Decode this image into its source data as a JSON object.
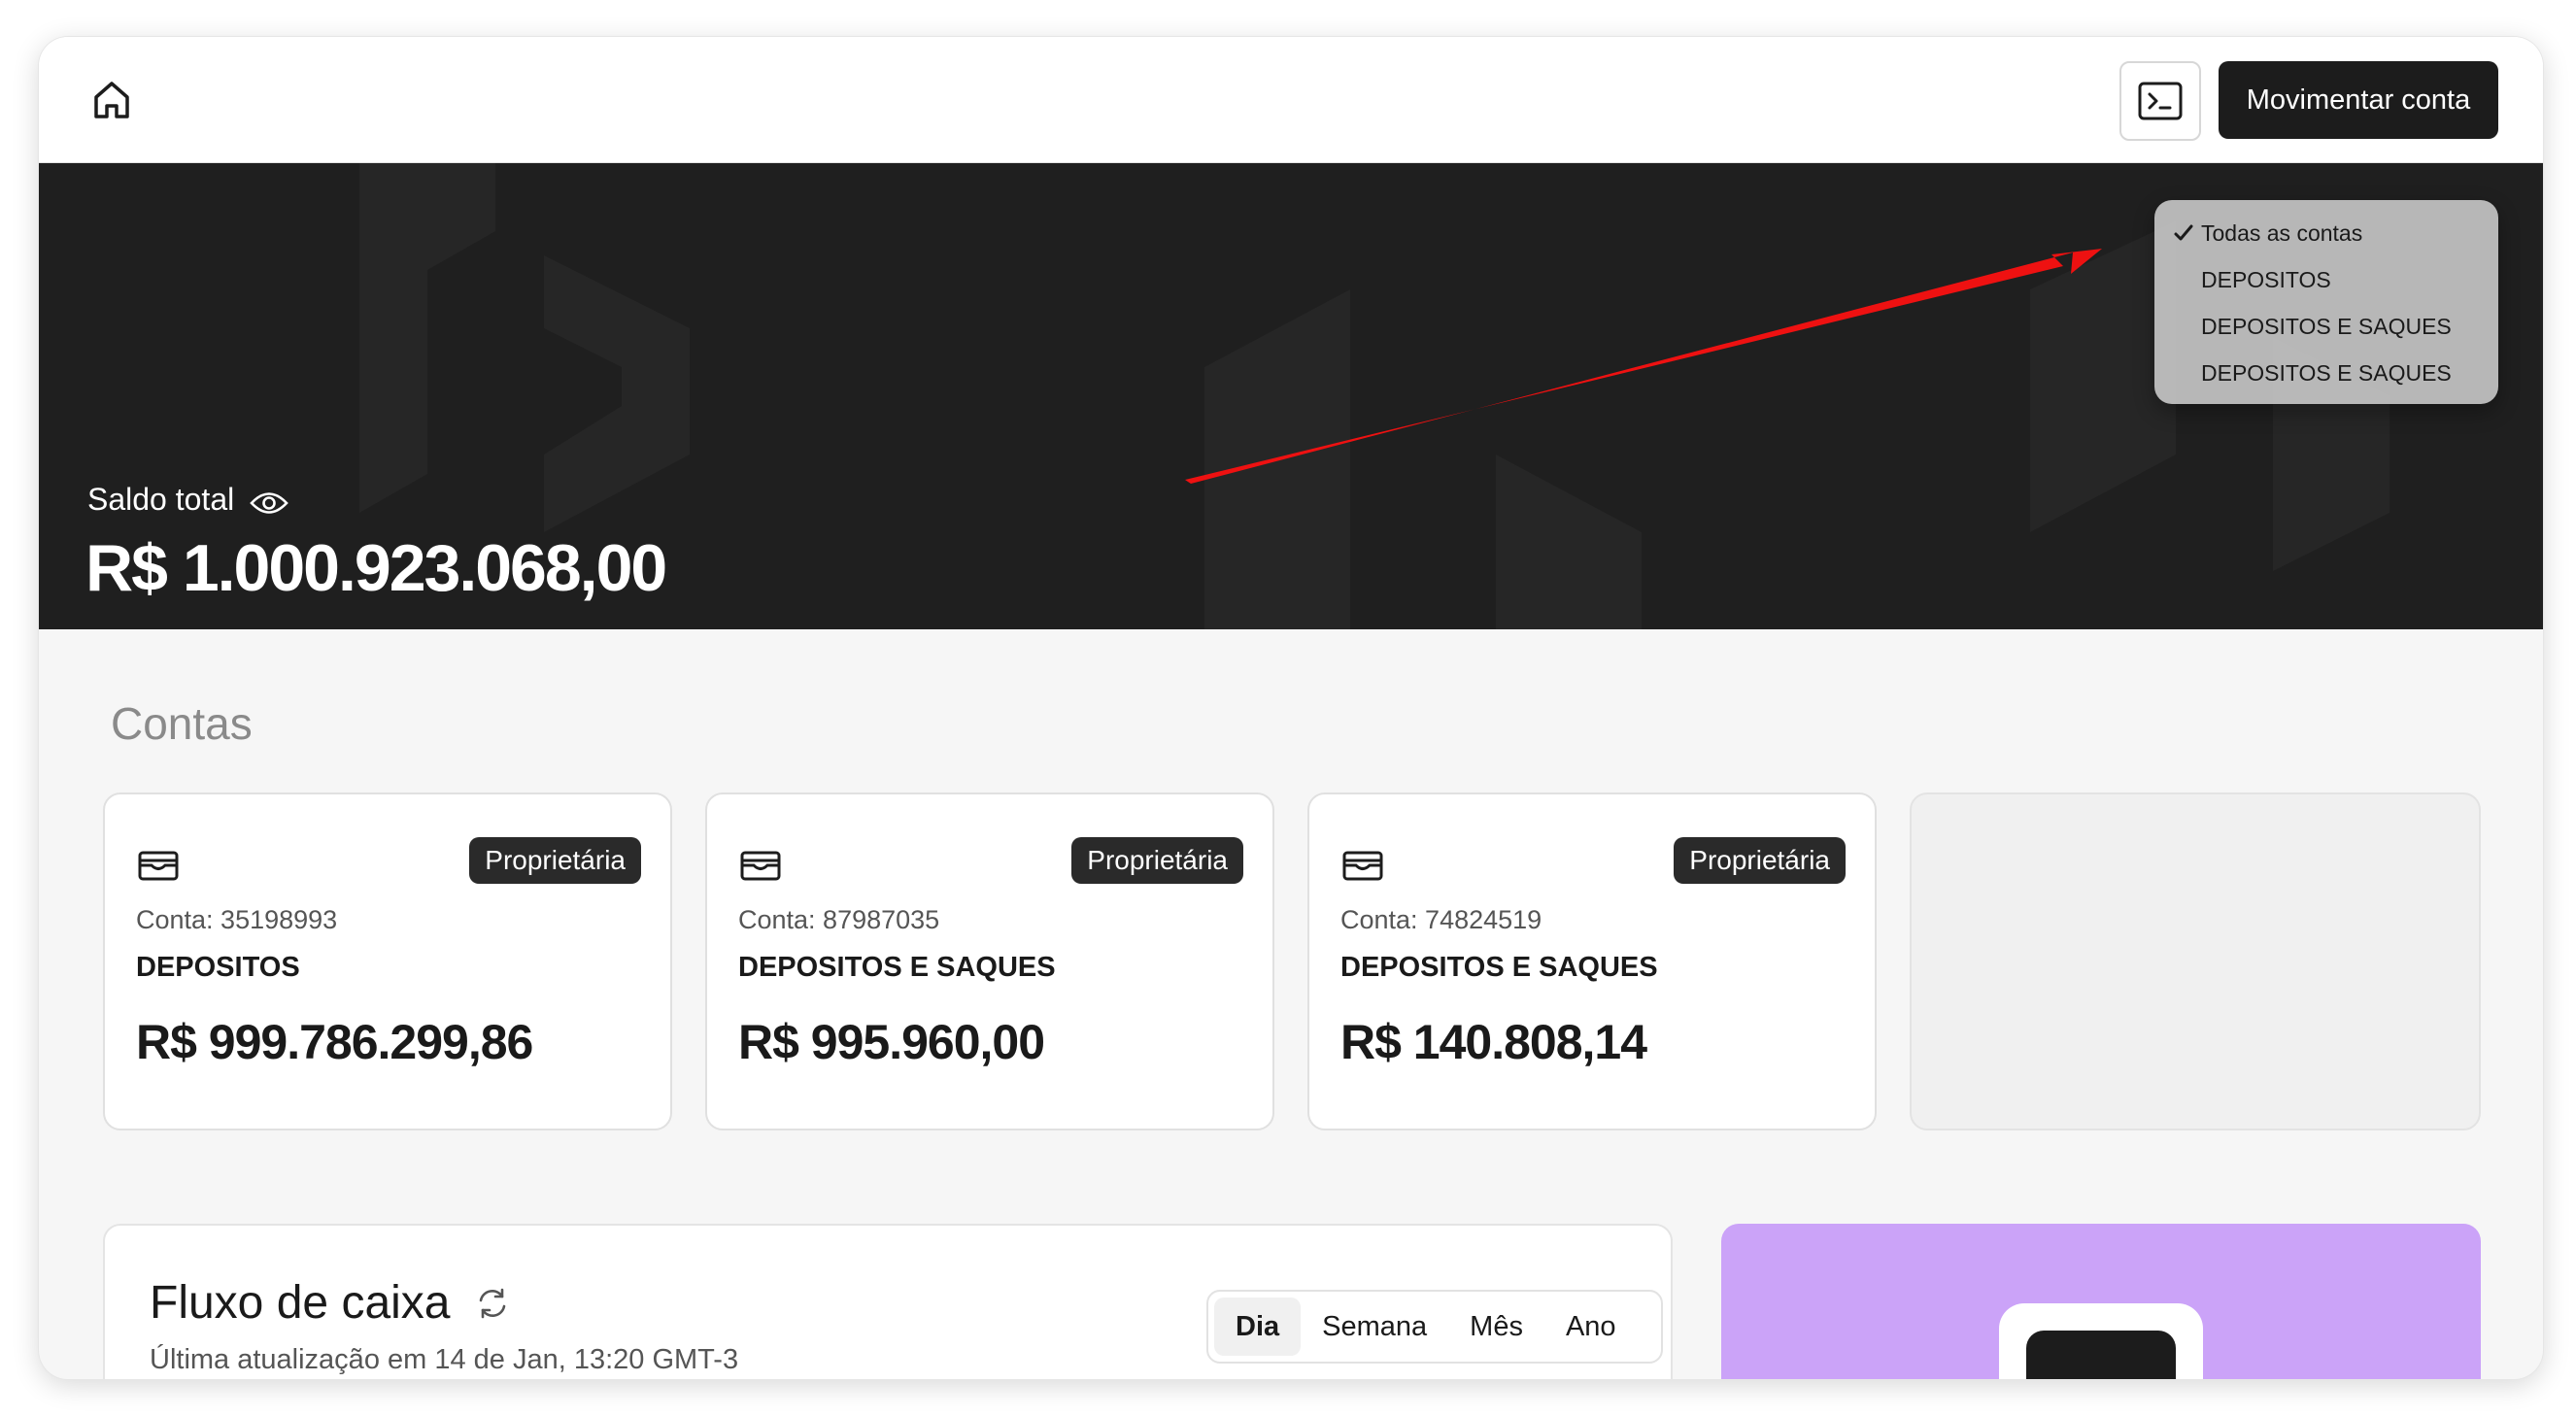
{
  "header": {
    "move_button_label": "Movimentar conta"
  },
  "hero": {
    "balance_label": "Saldo total",
    "balance_value": "R$ 1.000.923.068,00"
  },
  "account_filter": {
    "selected": "Todas as contas",
    "options": [
      "Todas as contas",
      "DEPOSITOS",
      "DEPOSITOS E SAQUES",
      "DEPOSITOS E SAQUES"
    ]
  },
  "accounts_section": {
    "title": "Contas",
    "cards": [
      {
        "badge": "Proprietária",
        "account": "Conta: 35198993",
        "name": "DEPOSITOS",
        "balance": "R$ 999.786.299,86"
      },
      {
        "badge": "Proprietária",
        "account": "Conta: 87987035",
        "name": "DEPOSITOS E SAQUES",
        "balance": "R$ 995.960,00"
      },
      {
        "badge": "Proprietária",
        "account": "Conta: 74824519",
        "name": "DEPOSITOS E SAQUES",
        "balance": "R$ 140.808,14"
      }
    ]
  },
  "cash_flow": {
    "title": "Fluxo de caixa",
    "last_update": "Última atualização em 14 de Jan, 13:20 GMT-3",
    "periods": [
      "Dia",
      "Semana",
      "Mês",
      "Ano"
    ],
    "active_period": "Dia"
  },
  "icons": {
    "home": "home-icon",
    "terminal": "terminal-icon",
    "eye": "eye-icon",
    "wallet": "wallet-icon",
    "refresh": "refresh-icon",
    "check": "check-icon"
  },
  "colors": {
    "hero_background": "#1f1f1f",
    "primary_button": "#1c1c1c",
    "badge": "#2a2a2a",
    "annotation_arrow": "#ee1111",
    "promo_card": "#cba3f8"
  }
}
